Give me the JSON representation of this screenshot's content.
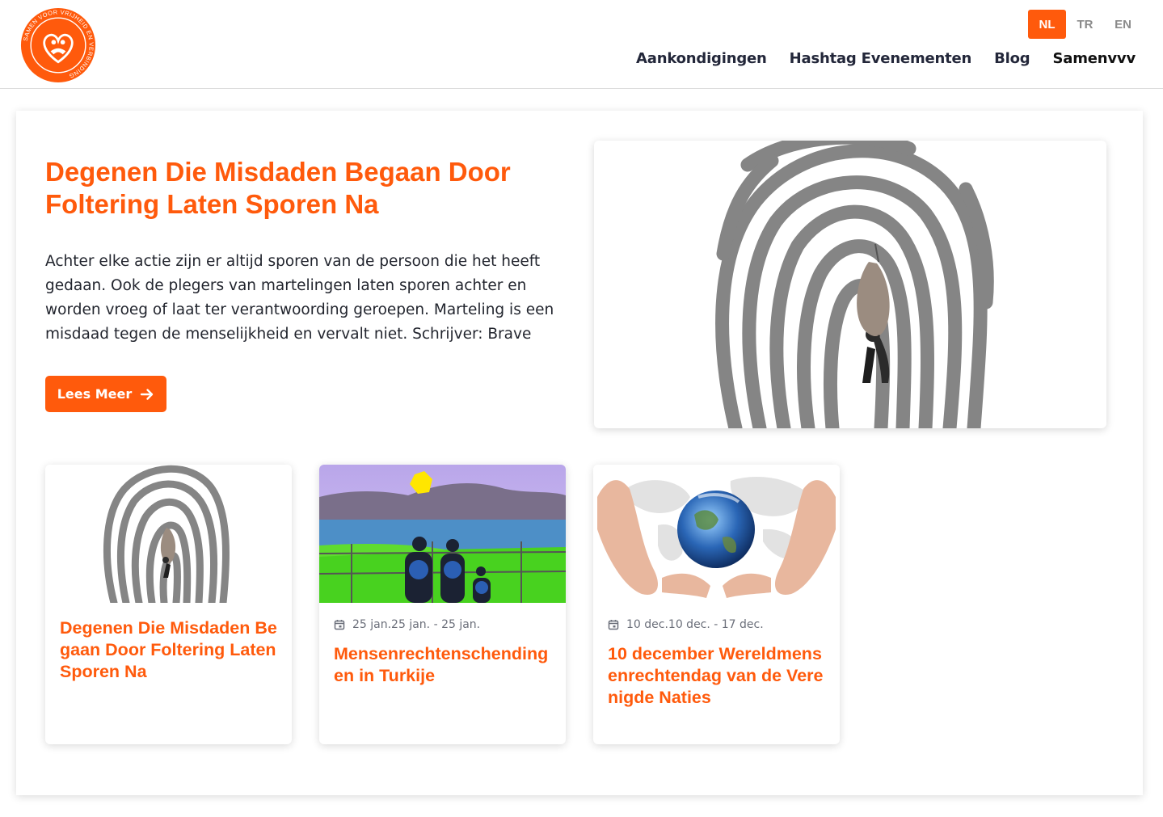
{
  "brand": {
    "logo_text": "SAMEN VOOR VRIJHEID EN VERBINDING",
    "accent": "#ff5a0c"
  },
  "languages": [
    {
      "label": "NL",
      "active": true
    },
    {
      "label": "TR",
      "active": false
    },
    {
      "label": "EN",
      "active": false
    }
  ],
  "nav": [
    "Aankondigingen",
    "Hashtag Evenementen",
    "Blog",
    "Samenvvv"
  ],
  "featured": {
    "title": "Degenen Die Misdaden Begaan Door Foltering Laten Sporen Na",
    "excerpt": "Achter elke actie zijn er altijd sporen van de persoon die het heeft gedaan. Ook de plegers van martelingen laten sporen achter en worden vroeg of laat ter verantwoording geroepen. Marteling is een misdaad tegen de menselijkheid en vervalt niet. Schrijver: Brave He…",
    "button_label": "Lees Meer",
    "button_icon": "arrow-right-icon",
    "image": "fingerprint-with-hanging-figure"
  },
  "cards": [
    {
      "title": "Degenen Die Misdaden Begaan Door Foltering Laten Sporen Na",
      "date": "",
      "image": "fingerprint-with-hanging-figure"
    },
    {
      "title": "Mensenrechtenschendingen in Turkije",
      "date": "25 jan.25 jan. - 25 jan.",
      "image": "family-behind-barbed-wire-by-sea"
    },
    {
      "title": "10 december Wereldmensenrechtendag van de Verenigde Naties",
      "date": "10 dec.10 dec. - 17 dec.",
      "image": "hands-around-earth"
    }
  ]
}
